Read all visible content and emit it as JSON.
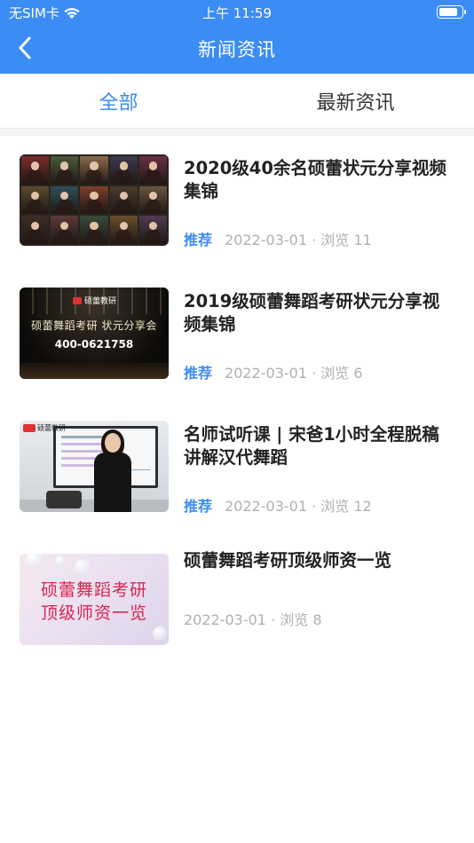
{
  "status_bar": {
    "carrier": "无SIM卡",
    "time": "上午 11:59",
    "battery_level": 0.85
  },
  "nav": {
    "title": "新闻资讯",
    "back_icon": "chevron-left-icon"
  },
  "tabs": [
    {
      "label": "全部",
      "active": true
    },
    {
      "label": "最新资讯",
      "active": false
    }
  ],
  "colors": {
    "accent": "#3b8cf5",
    "meta_text": "#b0b0b0",
    "thumb4_text": "#d8254f"
  },
  "news": [
    {
      "title": "2020级40余名硕蕾状元分享视频集锦",
      "tag": "推荐",
      "date": "2022-03-01",
      "views": "浏览 11",
      "thumb": {}
    },
    {
      "title": "2019级硕蕾舞蹈考研状元分享视频集锦",
      "tag": "推荐",
      "date": "2022-03-01",
      "views": "浏览 6",
      "thumb": {
        "logo": "硕蕾教研",
        "line1": "硕蕾舞蹈考研 状元分享会",
        "line2": "400-0621758"
      }
    },
    {
      "title": "名师试听课 | 宋爸1小时全程脱稿讲解汉代舞蹈",
      "tag": "推荐",
      "date": "2022-03-01",
      "views": "浏览 12",
      "thumb": {
        "logo": "硕蕾教研"
      }
    },
    {
      "title": "硕蕾舞蹈考研顶级师资一览",
      "tag": "",
      "date": "2022-03-01",
      "views": "浏览 8",
      "thumb": {
        "line1": "硕蕾舞蹈考研",
        "line2": "顶级师资一览"
      }
    }
  ]
}
